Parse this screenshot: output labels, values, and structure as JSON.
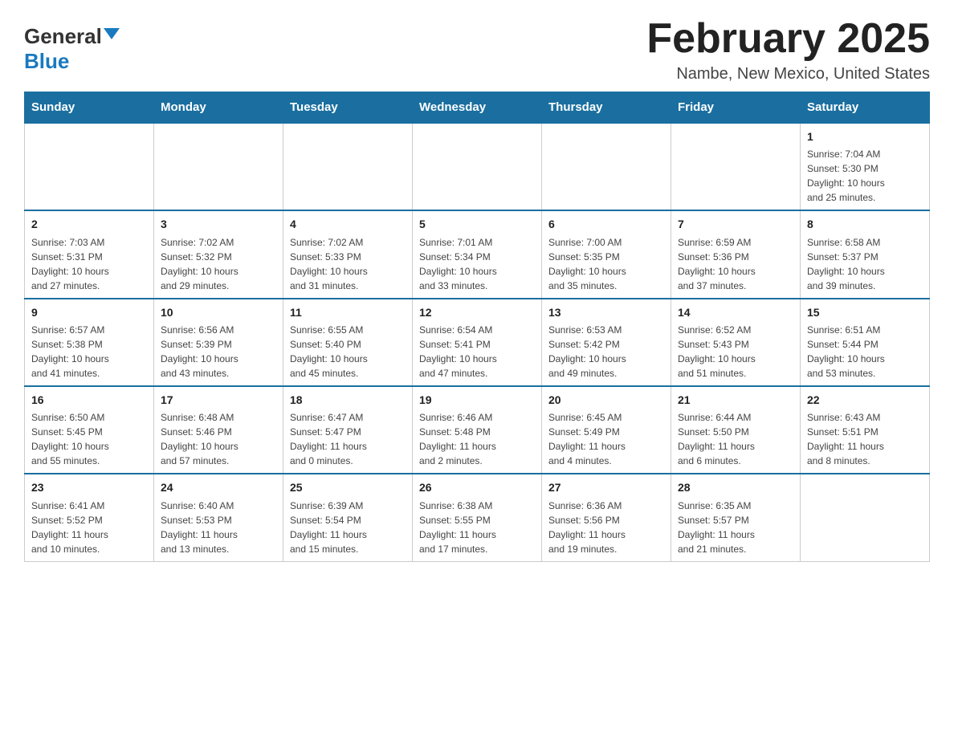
{
  "logo": {
    "text_general": "General",
    "text_blue": "Blue"
  },
  "header": {
    "title": "February 2025",
    "location": "Nambe, New Mexico, United States"
  },
  "weekdays": [
    "Sunday",
    "Monday",
    "Tuesday",
    "Wednesday",
    "Thursday",
    "Friday",
    "Saturday"
  ],
  "weeks": [
    [
      {
        "day": "",
        "info": ""
      },
      {
        "day": "",
        "info": ""
      },
      {
        "day": "",
        "info": ""
      },
      {
        "day": "",
        "info": ""
      },
      {
        "day": "",
        "info": ""
      },
      {
        "day": "",
        "info": ""
      },
      {
        "day": "1",
        "info": "Sunrise: 7:04 AM\nSunset: 5:30 PM\nDaylight: 10 hours\nand 25 minutes."
      }
    ],
    [
      {
        "day": "2",
        "info": "Sunrise: 7:03 AM\nSunset: 5:31 PM\nDaylight: 10 hours\nand 27 minutes."
      },
      {
        "day": "3",
        "info": "Sunrise: 7:02 AM\nSunset: 5:32 PM\nDaylight: 10 hours\nand 29 minutes."
      },
      {
        "day": "4",
        "info": "Sunrise: 7:02 AM\nSunset: 5:33 PM\nDaylight: 10 hours\nand 31 minutes."
      },
      {
        "day": "5",
        "info": "Sunrise: 7:01 AM\nSunset: 5:34 PM\nDaylight: 10 hours\nand 33 minutes."
      },
      {
        "day": "6",
        "info": "Sunrise: 7:00 AM\nSunset: 5:35 PM\nDaylight: 10 hours\nand 35 minutes."
      },
      {
        "day": "7",
        "info": "Sunrise: 6:59 AM\nSunset: 5:36 PM\nDaylight: 10 hours\nand 37 minutes."
      },
      {
        "day": "8",
        "info": "Sunrise: 6:58 AM\nSunset: 5:37 PM\nDaylight: 10 hours\nand 39 minutes."
      }
    ],
    [
      {
        "day": "9",
        "info": "Sunrise: 6:57 AM\nSunset: 5:38 PM\nDaylight: 10 hours\nand 41 minutes."
      },
      {
        "day": "10",
        "info": "Sunrise: 6:56 AM\nSunset: 5:39 PM\nDaylight: 10 hours\nand 43 minutes."
      },
      {
        "day": "11",
        "info": "Sunrise: 6:55 AM\nSunset: 5:40 PM\nDaylight: 10 hours\nand 45 minutes."
      },
      {
        "day": "12",
        "info": "Sunrise: 6:54 AM\nSunset: 5:41 PM\nDaylight: 10 hours\nand 47 minutes."
      },
      {
        "day": "13",
        "info": "Sunrise: 6:53 AM\nSunset: 5:42 PM\nDaylight: 10 hours\nand 49 minutes."
      },
      {
        "day": "14",
        "info": "Sunrise: 6:52 AM\nSunset: 5:43 PM\nDaylight: 10 hours\nand 51 minutes."
      },
      {
        "day": "15",
        "info": "Sunrise: 6:51 AM\nSunset: 5:44 PM\nDaylight: 10 hours\nand 53 minutes."
      }
    ],
    [
      {
        "day": "16",
        "info": "Sunrise: 6:50 AM\nSunset: 5:45 PM\nDaylight: 10 hours\nand 55 minutes."
      },
      {
        "day": "17",
        "info": "Sunrise: 6:48 AM\nSunset: 5:46 PM\nDaylight: 10 hours\nand 57 minutes."
      },
      {
        "day": "18",
        "info": "Sunrise: 6:47 AM\nSunset: 5:47 PM\nDaylight: 11 hours\nand 0 minutes."
      },
      {
        "day": "19",
        "info": "Sunrise: 6:46 AM\nSunset: 5:48 PM\nDaylight: 11 hours\nand 2 minutes."
      },
      {
        "day": "20",
        "info": "Sunrise: 6:45 AM\nSunset: 5:49 PM\nDaylight: 11 hours\nand 4 minutes."
      },
      {
        "day": "21",
        "info": "Sunrise: 6:44 AM\nSunset: 5:50 PM\nDaylight: 11 hours\nand 6 minutes."
      },
      {
        "day": "22",
        "info": "Sunrise: 6:43 AM\nSunset: 5:51 PM\nDaylight: 11 hours\nand 8 minutes."
      }
    ],
    [
      {
        "day": "23",
        "info": "Sunrise: 6:41 AM\nSunset: 5:52 PM\nDaylight: 11 hours\nand 10 minutes."
      },
      {
        "day": "24",
        "info": "Sunrise: 6:40 AM\nSunset: 5:53 PM\nDaylight: 11 hours\nand 13 minutes."
      },
      {
        "day": "25",
        "info": "Sunrise: 6:39 AM\nSunset: 5:54 PM\nDaylight: 11 hours\nand 15 minutes."
      },
      {
        "day": "26",
        "info": "Sunrise: 6:38 AM\nSunset: 5:55 PM\nDaylight: 11 hours\nand 17 minutes."
      },
      {
        "day": "27",
        "info": "Sunrise: 6:36 AM\nSunset: 5:56 PM\nDaylight: 11 hours\nand 19 minutes."
      },
      {
        "day": "28",
        "info": "Sunrise: 6:35 AM\nSunset: 5:57 PM\nDaylight: 11 hours\nand 21 minutes."
      },
      {
        "day": "",
        "info": ""
      }
    ]
  ]
}
